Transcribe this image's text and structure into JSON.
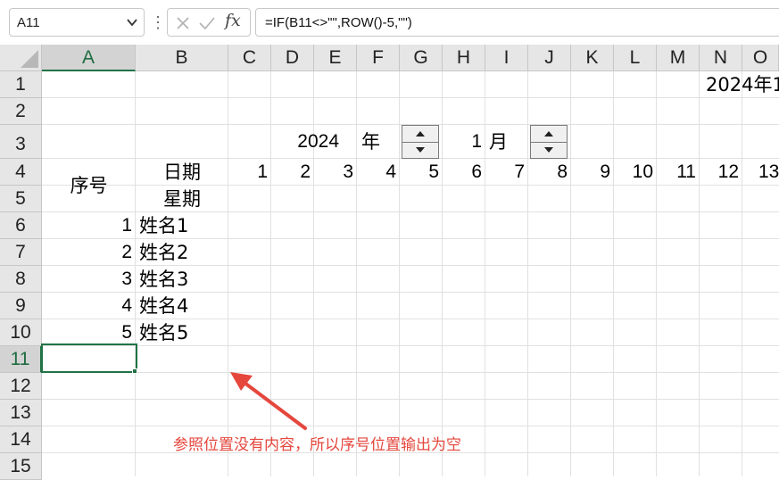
{
  "formula_bar": {
    "name_box": "A11",
    "cancel_icon": "cancel-icon",
    "enter_icon": "check-icon",
    "fx_label": "fx",
    "formula": "=IF(B11<>\"\",ROW()-5,\"\")"
  },
  "columns": [
    "A",
    "B",
    "C",
    "D",
    "E",
    "F",
    "G",
    "H",
    "I",
    "J",
    "K",
    "L",
    "M",
    "N",
    "O"
  ],
  "rows": [
    "1",
    "2",
    "3",
    "4",
    "5",
    "6",
    "7",
    "8",
    "9",
    "10",
    "11",
    "12",
    "13",
    "14",
    "15"
  ],
  "selected_cell": "A11",
  "cells": {
    "N1": "2024年1",
    "D3": "2024",
    "F3": "年",
    "I3": "1",
    "J3": "月",
    "A4": "序号",
    "B4": "日期",
    "B5": "星期",
    "day_numbers": [
      "1",
      "2",
      "3",
      "4",
      "5",
      "6",
      "7",
      "8",
      "9",
      "10",
      "11",
      "12",
      "13"
    ],
    "list": [
      {
        "index": "1",
        "name": "姓名1"
      },
      {
        "index": "2",
        "name": "姓名2"
      },
      {
        "index": "3",
        "name": "姓名3"
      },
      {
        "index": "4",
        "name": "姓名4"
      },
      {
        "index": "5",
        "name": "姓名5"
      }
    ]
  },
  "annotation": {
    "text": "参照位置没有内容，所以序号位置输出为空",
    "color": "#e5473d"
  },
  "colors": {
    "selection": "#217346",
    "header_bg": "#e6e6e6",
    "gridline": "#e1e1e1"
  }
}
